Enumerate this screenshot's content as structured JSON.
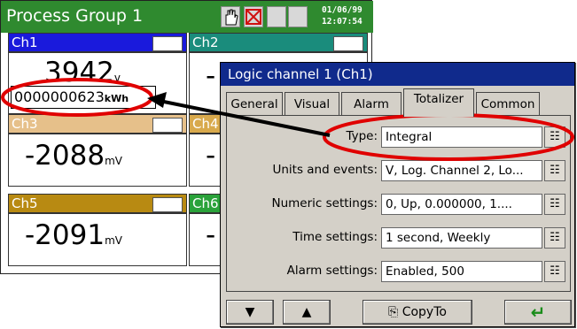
{
  "app": {
    "title": "Process Group 1",
    "date": "01/06/99",
    "time": "12:07:54"
  },
  "channels": [
    {
      "name": "Ch1",
      "value": "3942",
      "unit": "v",
      "totalizer": "0000000623",
      "totalizer_unit": "kWh",
      "color": "#1a1adc"
    },
    {
      "name": "Ch2",
      "value": "-",
      "unit": "",
      "color": "#1a8c7c"
    },
    {
      "name": "Ch3",
      "value": "-2088",
      "unit": "mV",
      "color": "#e6c08a"
    },
    {
      "name": "Ch4",
      "value": "-",
      "unit": "",
      "color": "#d8a94c"
    },
    {
      "name": "Ch5",
      "value": "-2091",
      "unit": "mV",
      "color": "#b88a12"
    },
    {
      "name": "Ch6",
      "value": "-",
      "unit": "",
      "color": "#2aa23a"
    }
  ],
  "dialog": {
    "title": "Logic channel 1 (Ch1)",
    "tabs": [
      "General",
      "Visual",
      "Alarm",
      "Totalizer",
      "Common"
    ],
    "active_tab": "Totalizer",
    "fields": [
      {
        "label": "Type:",
        "value": "Integral"
      },
      {
        "label": "Units and events:",
        "value": "V, Log. Channel 2, Lo..."
      },
      {
        "label": "Numeric settings:",
        "value": "0, Up, 0.000000, 1...."
      },
      {
        "label": "Time settings:",
        "value": "1 second, Weekly"
      },
      {
        "label": "Alarm settings:",
        "value": "Enabled, 500"
      }
    ],
    "copy_label": "CopyTo"
  },
  "icons": [
    "hand-icon",
    "red-x-icon",
    "move-down-icon",
    "move-up-icon",
    "copy-icon",
    "enter-icon",
    "properties-icon"
  ]
}
